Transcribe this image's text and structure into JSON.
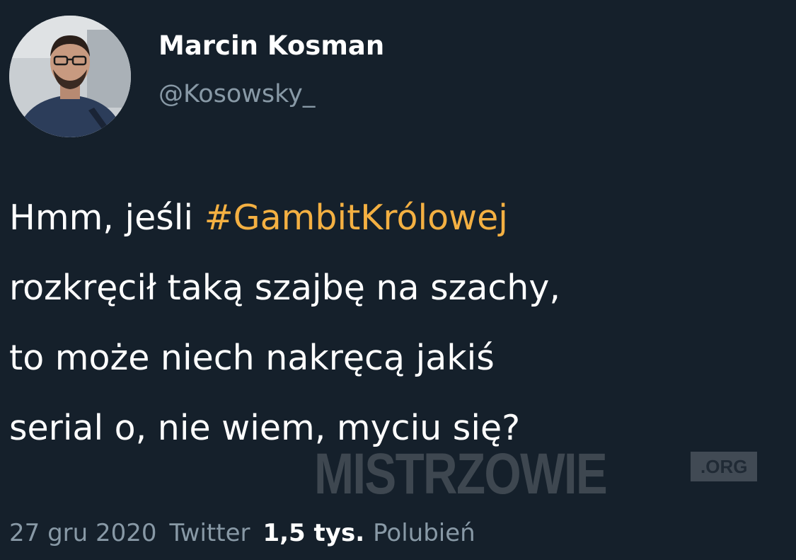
{
  "tweet": {
    "author": {
      "display_name": "Marcin Kosman",
      "handle": "@Kosowsky_",
      "avatar_icon": "profile-photo"
    },
    "text_lines": [
      {
        "prefix": "Hmm, jeśli ",
        "hashtag": "#GambitKrólowej"
      },
      {
        "text": "rozkręcił taką szajbę na szachy,"
      },
      {
        "text": "to może niech nakręcą jakiś"
      },
      {
        "text": "serial o, nie wiem, myciu się?"
      }
    ],
    "date": "27 gru 2020",
    "source": "Twitter",
    "likes_count": "1,5 tys.",
    "likes_label": "Polubień"
  },
  "watermark": {
    "main": "MISTRZOWIE",
    "suffix": ".ORG"
  },
  "colors": {
    "background": "#15202b",
    "text": "#ffffff",
    "secondary": "#8899a6",
    "hashtag": "#f4b042"
  }
}
